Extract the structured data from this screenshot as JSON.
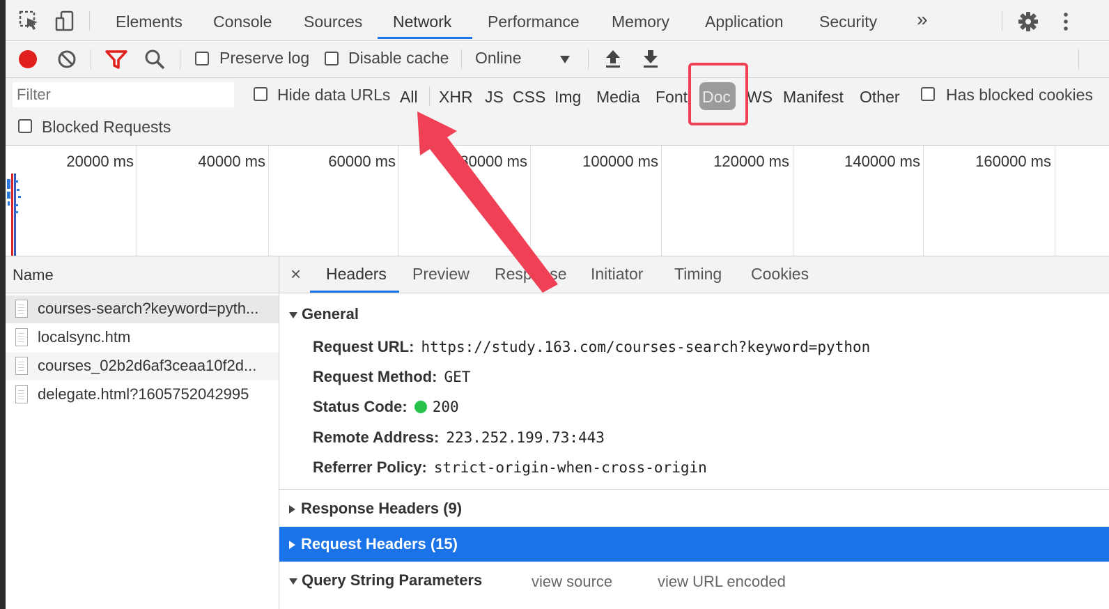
{
  "tabs": [
    "Elements",
    "Console",
    "Sources",
    "Network",
    "Performance",
    "Memory",
    "Application",
    "Security"
  ],
  "more_tabs": "»",
  "toolbar": {
    "preserve_log": "Preserve log",
    "disable_cache": "Disable cache",
    "throttling": "Online"
  },
  "filter": {
    "placeholder": "Filter",
    "hide_data_urls": "Hide data URLs",
    "types": [
      "All",
      "XHR",
      "JS",
      "CSS",
      "Img",
      "Media",
      "Font",
      "Doc",
      "WS",
      "Manifest",
      "Other"
    ],
    "active_type": "Doc",
    "has_blocked_cookies": "Has blocked cookies",
    "blocked_requests": "Blocked Requests"
  },
  "timeline": {
    "ticks": [
      "20000 ms",
      "40000 ms",
      "60000 ms",
      "80000 ms",
      "100000 ms",
      "120000 ms",
      "140000 ms",
      "160000 ms"
    ]
  },
  "requests": {
    "header": "Name",
    "items": [
      "courses-search?keyword=pyth...",
      "localsync.htm",
      "courses_02b2d6af3ceaa10f2d...",
      "delegate.html?1605752042995"
    ]
  },
  "details": {
    "close": "×",
    "tabs": [
      "Headers",
      "Preview",
      "Response",
      "Initiator",
      "Timing",
      "Cookies"
    ],
    "general": {
      "title": "General",
      "request_url_label": "Request URL:",
      "request_url": "https://study.163.com/courses-search?keyword=python",
      "method_label": "Request Method:",
      "method": "GET",
      "status_label": "Status Code:",
      "status": "200",
      "remote_label": "Remote Address:",
      "remote": "223.252.199.73:443",
      "referrer_label": "Referrer Policy:",
      "referrer": "strict-origin-when-cross-origin"
    },
    "response_headers": "Response Headers (9)",
    "request_headers": "Request Headers (15)",
    "query_params": "Query String Parameters",
    "view_source": "view source",
    "view_url_encoded": "view URL encoded"
  },
  "colors": {
    "accent": "#1a73e8",
    "record": "#e0201c",
    "annotation": "#ef4055",
    "status_ok": "#27c24c"
  }
}
